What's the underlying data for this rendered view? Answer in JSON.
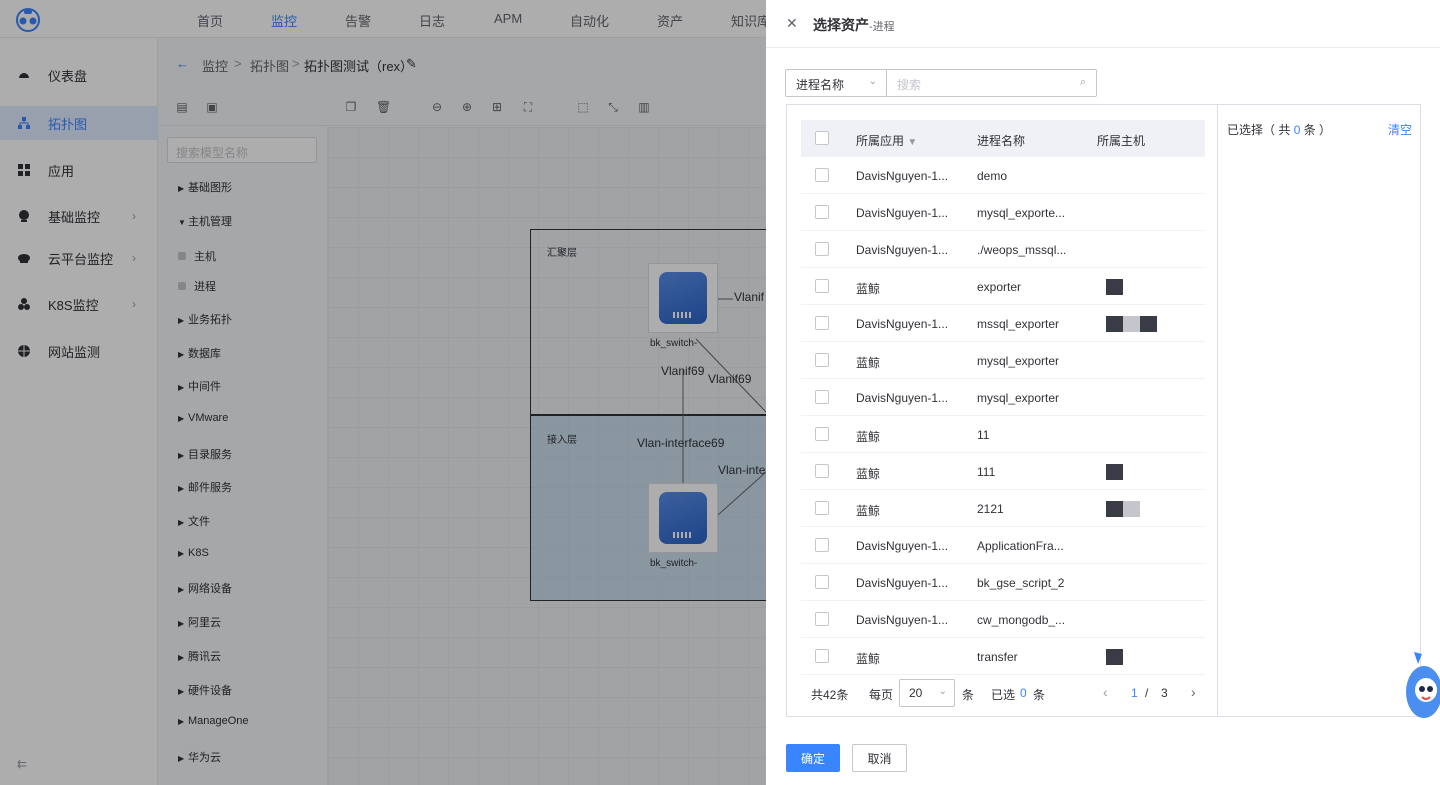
{
  "topnav": {
    "items": [
      "首页",
      "监控",
      "告警",
      "日志",
      "APM",
      "自动化",
      "资产",
      "知识库"
    ],
    "active_index": 1
  },
  "sidebar": {
    "items": [
      {
        "label": "仪表盘",
        "icon": "dashboard-icon",
        "has_arrow": false
      },
      {
        "label": "拓扑图",
        "icon": "topology-icon",
        "has_arrow": false
      },
      {
        "label": "应用",
        "icon": "grid-icon",
        "has_arrow": false
      },
      {
        "label": "基础监控",
        "icon": "monitor-icon",
        "has_arrow": true
      },
      {
        "label": "云平台监控",
        "icon": "cloud-icon",
        "has_arrow": true
      },
      {
        "label": "K8S监控",
        "icon": "k8s-icon",
        "has_arrow": true
      },
      {
        "label": "网站监测",
        "icon": "globe-icon",
        "has_arrow": false
      }
    ],
    "active_index": 1,
    "collapse_glyph": "⇇"
  },
  "breadcrumb": {
    "back": "←",
    "items": [
      "监控",
      "拓扑图",
      "拓扑图测试（rex）"
    ],
    "separator": ">",
    "edit_glyph": "✎"
  },
  "toolbar": {
    "icons": [
      "table-icon",
      "image-icon",
      "copy-icon",
      "delete-icon",
      "zoom-out-icon",
      "zoom-in-icon",
      "fit-icon",
      "fullscreen-icon",
      "select-icon",
      "connect-icon",
      "chart-icon"
    ]
  },
  "tree": {
    "search_placeholder": "搜索模型名称",
    "nodes": [
      {
        "label": "基础图形",
        "expanded": false
      },
      {
        "label": "主机管理",
        "expanded": true,
        "children": [
          "主机",
          "进程"
        ]
      },
      {
        "label": "业务拓扑",
        "expanded": false
      },
      {
        "label": "数据库",
        "expanded": false
      },
      {
        "label": "中间件",
        "expanded": false
      },
      {
        "label": "VMware",
        "expanded": false
      },
      {
        "label": "目录服务",
        "expanded": false
      },
      {
        "label": "邮件服务",
        "expanded": false
      },
      {
        "label": "文件",
        "expanded": false
      },
      {
        "label": "K8S",
        "expanded": false
      },
      {
        "label": "网络设备",
        "expanded": false
      },
      {
        "label": "阿里云",
        "expanded": false
      },
      {
        "label": "腾讯云",
        "expanded": false
      },
      {
        "label": "硬件设备",
        "expanded": false
      },
      {
        "label": "ManageOne",
        "expanded": false
      },
      {
        "label": "华为云",
        "expanded": false
      }
    ]
  },
  "canvas": {
    "zones": [
      "汇聚层",
      "接入层"
    ],
    "nodes": [
      "bk_switch-",
      "bk_switch-"
    ],
    "edge_labels": [
      "Vlanif",
      "Vlanif69",
      "Vlanif69",
      "Vlan-interface69",
      "Vlan-inte"
    ]
  },
  "drawer": {
    "title": "选择资产",
    "subtitle": "-进程",
    "close_glyph": "✕",
    "filter_field": "进程名称",
    "search_placeholder": "搜索",
    "columns": [
      "所属应用",
      "进程名称",
      "所属主机"
    ],
    "rows": [
      {
        "app": "DavisNguyen-1...",
        "process": "demo"
      },
      {
        "app": "DavisNguyen-1...",
        "process": "mysql_exporte..."
      },
      {
        "app": "DavisNguyen-1...",
        "process": "./weops_mssql..."
      },
      {
        "app": "蓝鲸",
        "process": "exporter"
      },
      {
        "app": "DavisNguyen-1...",
        "process": "mssql_exporter"
      },
      {
        "app": "蓝鲸",
        "process": "mysql_exporter"
      },
      {
        "app": "DavisNguyen-1...",
        "process": "mysql_exporter"
      },
      {
        "app": "蓝鲸",
        "process": "11"
      },
      {
        "app": "蓝鲸",
        "process": "111"
      },
      {
        "app": "蓝鲸",
        "process": "2121"
      },
      {
        "app": "DavisNguyen-1...",
        "process": "ApplicationFra..."
      },
      {
        "app": "DavisNguyen-1...",
        "process": "bk_gse_script_2"
      },
      {
        "app": "DavisNguyen-1...",
        "process": "cw_mongodb_..."
      },
      {
        "app": "蓝鲸",
        "process": "transfer"
      }
    ],
    "pagination": {
      "total": "共42条",
      "per_page_label": "每页",
      "per_page": "20",
      "unit": "条",
      "selected_label": "已选",
      "selected": "0",
      "selected_unit": "条",
      "current_page": "1",
      "slash": "/",
      "total_pages": "3",
      "prev": "‹",
      "next": "›"
    },
    "selected_panel": {
      "prefix": "已选择（ 共",
      "count": "0",
      "suffix": "条 ）",
      "clear": "清空"
    },
    "confirm": "确定",
    "cancel": "取消"
  },
  "colors": {
    "accent": "#3a84ff",
    "overlay": "rgba(0,0,0,0.32)"
  }
}
